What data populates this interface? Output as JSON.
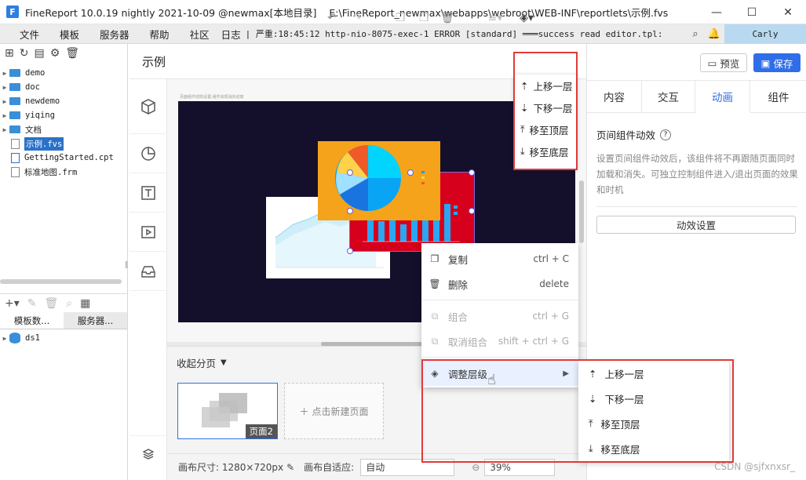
{
  "titlebar": {
    "app": "FineReport 10.0.19 nightly 2021-10-09 @newmax[本地目录]",
    "path": "E:\\FineReport_newmax\\webapps\\webroot\\WEB-INF\\reportlets\\示例.fvs"
  },
  "menu": {
    "items": [
      "文件",
      "模板",
      "服务器",
      "帮助",
      "社区",
      "日志"
    ],
    "log": "| 严重:18:45:12 http-nio-8075-exec-1 ERROR [standard] ═══success read editor.tpl: reportle...",
    "user": "Carly"
  },
  "tree": {
    "items": [
      {
        "name": "demo",
        "type": "folder"
      },
      {
        "name": "doc",
        "type": "folder"
      },
      {
        "name": "newdemo",
        "type": "folder"
      },
      {
        "name": "yiqing",
        "type": "folder"
      },
      {
        "name": "文档",
        "type": "folder"
      },
      {
        "name": "示例.fvs",
        "type": "file",
        "selected": true
      },
      {
        "name": "GettingStarted.cpt",
        "type": "file"
      },
      {
        "name": "标准地图.frm",
        "type": "file"
      }
    ]
  },
  "lower_tabs": [
    "模板数...",
    "服务器..."
  ],
  "datasource": "ds1",
  "editor": {
    "page_title": "示例",
    "canvas_hint": "页面组件动效设置,组件出现消失动效"
  },
  "layer_menu": [
    "上移一层",
    "下移一层",
    "移至顶层",
    "移至底层"
  ],
  "context_menu": [
    {
      "label": "复制",
      "shortcut": "ctrl + C",
      "enabled": true
    },
    {
      "label": "删除",
      "shortcut": "delete",
      "enabled": true
    },
    {
      "label": "组合",
      "shortcut": "ctrl + G",
      "enabled": false
    },
    {
      "label": "取消组合",
      "shortcut": "shift + ctrl + G",
      "enabled": false
    },
    {
      "label": "调整层级",
      "shortcut": "",
      "enabled": true
    }
  ],
  "submenu": [
    "上移一层",
    "下移一层",
    "移至顶层",
    "移至底层"
  ],
  "pages": {
    "collapse": "收起分页",
    "page_label": "页面2",
    "new_page": "点击新建页面"
  },
  "bottom": {
    "canvas_size": "画布尺寸: 1280×720px",
    "adapt_label": "画布自适应:",
    "adapt_value": "自动",
    "zoom": "39%"
  },
  "right": {
    "preview": "预览",
    "save": "保存",
    "tabs": [
      "内容",
      "交互",
      "动画",
      "组件"
    ],
    "active_tab": "动画",
    "section_title": "页间组件动效",
    "desc": "设置页间组件动效后，该组件将不再跟随页面同时加载和消失。可独立控制组件进入/退出页面的效果和时机",
    "button": "动效设置"
  },
  "watermark": "CSDN @sjfxnxsr_",
  "colors": {
    "accent": "#2f6ee8",
    "highlight": "#e03a3a",
    "canvas": "#14102c"
  }
}
